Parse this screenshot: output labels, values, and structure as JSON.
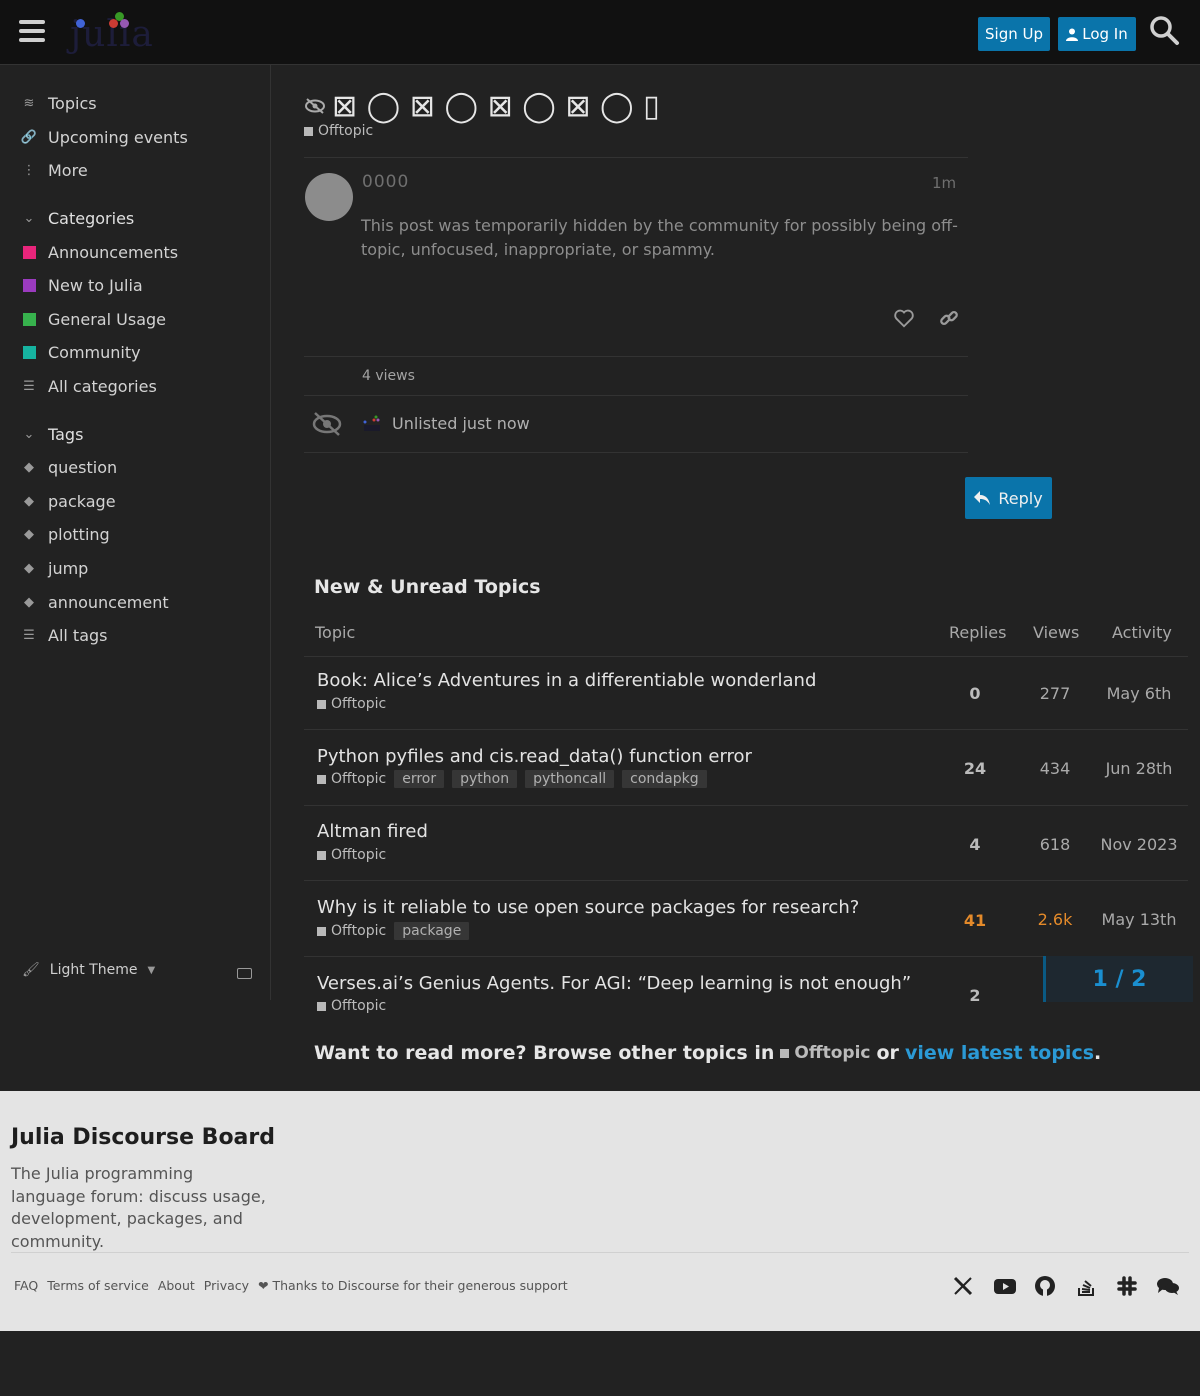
{
  "header": {
    "logo_text": "julia",
    "signup_label": "Sign Up",
    "login_label": "Log In"
  },
  "sidebar": {
    "nav": [
      {
        "label": "Topics",
        "icon": "layers-icon"
      },
      {
        "label": "Upcoming events",
        "icon": "link-icon"
      },
      {
        "label": "More",
        "icon": "more-vertical-icon"
      }
    ],
    "categories_heading": "Categories",
    "categories": [
      {
        "label": "Announcements",
        "color": "#e8257b"
      },
      {
        "label": "New to Julia",
        "color": "#9b3bbf"
      },
      {
        "label": "General Usage",
        "color": "#37b24d"
      },
      {
        "label": "Community",
        "color": "#16b3a0"
      }
    ],
    "all_categories": "All categories",
    "tags_heading": "Tags",
    "tags": [
      "question",
      "package",
      "plotting",
      "jump",
      "announcement"
    ],
    "all_tags": "All tags",
    "theme_label": "Light Theme"
  },
  "topic": {
    "title_glyphs": "⊠ ◯ ⊠ ◯ ⊠ ◯ ⊠ ◯ ▯",
    "category": "Offtopic",
    "username": "0000",
    "age": "1m",
    "body": "This post was temporarily hidden by the community for possibly being off-topic, unfocused, inappropriate, or spammy.",
    "views": "4 views",
    "unlisted": "Unlisted just now",
    "reply_label": "Reply"
  },
  "suggested": {
    "heading": "New & Unread Topics",
    "columns": {
      "topic": "Topic",
      "replies": "Replies",
      "views": "Views",
      "activity": "Activity"
    },
    "rows": [
      {
        "title": "Book: Alice’s Adventures in a differentiable wonderland",
        "category": "Offtopic",
        "tags": [],
        "replies": "0",
        "views": "277",
        "activity": "May 6th"
      },
      {
        "title": "Python pyfiles and cis.read_data() function error",
        "category": "Offtopic",
        "tags": [
          "error",
          "python",
          "pythoncall",
          "condapkg"
        ],
        "replies": "24",
        "views": "434",
        "activity": "Jun 28th"
      },
      {
        "title": "Altman fired",
        "category": "Offtopic",
        "tags": [],
        "replies": "4",
        "views": "618",
        "activity": "Nov 2023"
      },
      {
        "title": "Why is it reliable to use open source packages for research?",
        "category": "Offtopic",
        "tags": [
          "package"
        ],
        "replies": "41",
        "views": "2.6k",
        "activity": "May 13th"
      },
      {
        "title": "Verses.ai’s Genius Agents. For AGI: “Deep learning is not enough”",
        "category": "Offtopic",
        "tags": [],
        "replies": "2",
        "views": "",
        "activity": ""
      }
    ],
    "timeline": "1 / 2",
    "read_more_prefix": "Want to read more? Browse other topics in",
    "read_more_category": "Offtopic",
    "read_more_or": "or",
    "read_more_link": "view latest topics",
    "read_more_end": "."
  },
  "footer": {
    "title": "Julia Discourse Board",
    "description": "The Julia programming language forum: discuss usage, development, packages, and community.",
    "links": [
      "FAQ",
      "Terms of service",
      "About",
      "Privacy",
      "❤ Thanks to Discourse for their generous support"
    ],
    "social": [
      "x-icon",
      "youtube-icon",
      "github-icon",
      "stackoverflow-icon",
      "slack-icon",
      "chat-icon"
    ]
  },
  "colors": {
    "accent": "#0a74aa",
    "hot": "#e48a2a",
    "link": "#2b9ad6"
  }
}
